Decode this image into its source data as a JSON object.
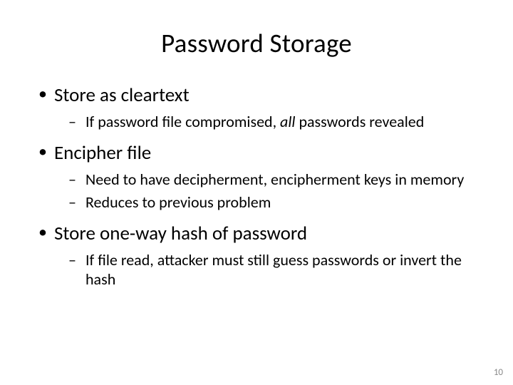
{
  "title": "Password Storage",
  "bullets": [
    {
      "text": "Store as cleartext",
      "sub": [
        {
          "pre": "If password file compromised, ",
          "em": "all",
          "post": " passwords revealed"
        }
      ]
    },
    {
      "text": "Encipher file",
      "sub": [
        {
          "pre": "Need to have decipherment, encipherment keys in memory"
        },
        {
          "pre": "Reduces to previous problem"
        }
      ]
    },
    {
      "text": "Store one-way hash of password",
      "sub": [
        {
          "pre": "If file read, attacker must still guess passwords or invert the hash"
        }
      ]
    }
  ],
  "page_number": "10"
}
